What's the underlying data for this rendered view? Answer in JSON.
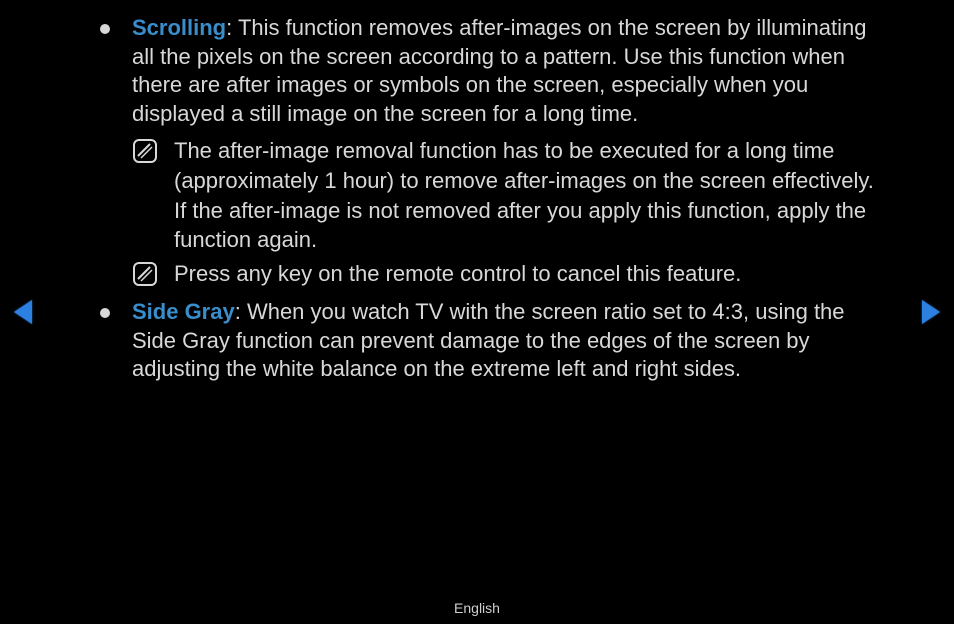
{
  "items": [
    {
      "term": "Scrolling",
      "desc": ": This function removes after-images on the screen by illuminating all the pixels on the screen according to a pattern. Use this function when there are after images or symbols on the screen, especially when you displayed a still image on the screen for a long time.",
      "notes": [
        "The after-image removal function has to be executed for a long time (approximately 1 hour) to remove after-images on the screen effectively. If the after-image is not removed after you apply this function, apply the function again.",
        "Press any key on the remote control to cancel this feature."
      ]
    },
    {
      "term": "Side Gray",
      "desc": ": When you watch TV with the screen ratio set to 4:3, using the Side Gray function can prevent damage to the edges of the screen by adjusting the white balance on the extreme left and right sides.",
      "notes": []
    }
  ],
  "footer": {
    "language": "English"
  }
}
